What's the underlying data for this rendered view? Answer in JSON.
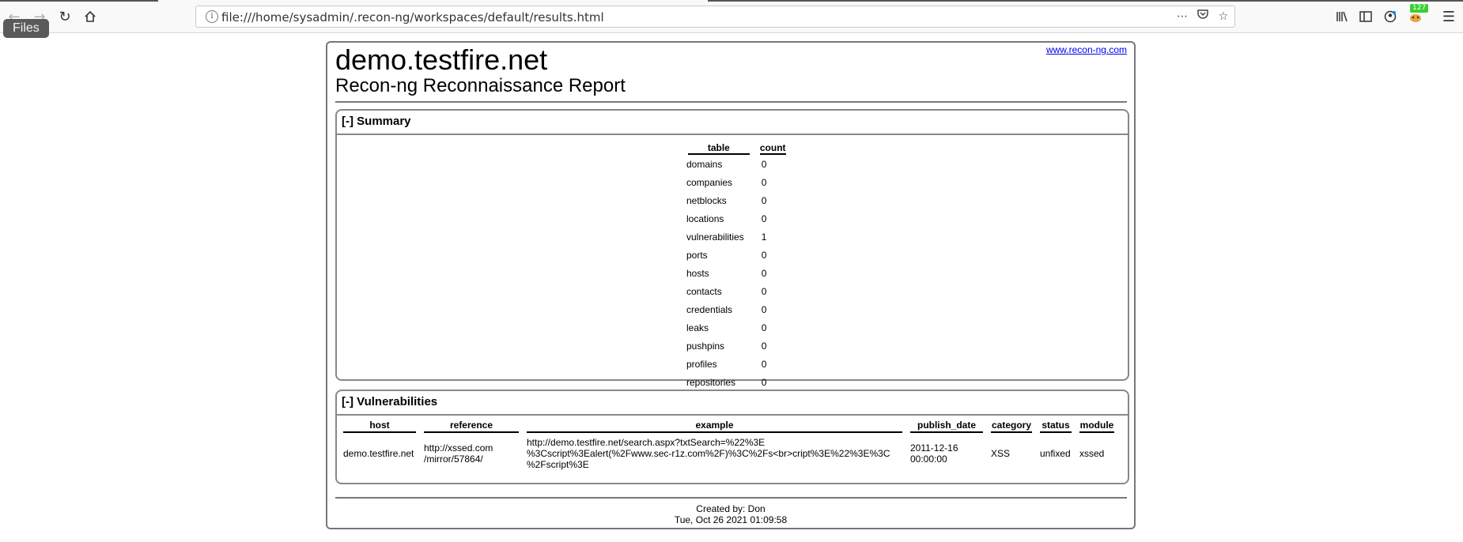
{
  "browser": {
    "url": "file:///home/sysadmin/.recon-ng/workspaces/default/results.html",
    "tooltip": "Files",
    "badge_count": "127",
    "icons": [
      "back-icon",
      "forward-icon",
      "reload-icon",
      "home-icon",
      "info-icon",
      "more-icon",
      "pocket-icon",
      "star-icon",
      "library-icon",
      "sidebar-icon",
      "account-icon",
      "extension-icon",
      "menu-icon"
    ]
  },
  "report": {
    "title": "demo.testfire.net",
    "subtitle": "Recon-ng Reconnaissance Report",
    "link": "www.recon-ng.com",
    "summary": {
      "heading": "[-] Summary",
      "columns": [
        "table",
        "count"
      ],
      "rows": [
        [
          "domains",
          "0"
        ],
        [
          "companies",
          "0"
        ],
        [
          "netblocks",
          "0"
        ],
        [
          "locations",
          "0"
        ],
        [
          "vulnerabilities",
          "1"
        ],
        [
          "ports",
          "0"
        ],
        [
          "hosts",
          "0"
        ],
        [
          "contacts",
          "0"
        ],
        [
          "credentials",
          "0"
        ],
        [
          "leaks",
          "0"
        ],
        [
          "pushpins",
          "0"
        ],
        [
          "profiles",
          "0"
        ],
        [
          "repositories",
          "0"
        ]
      ]
    },
    "vulnerabilities": {
      "heading": "[-] Vulnerabilities",
      "columns": [
        "host",
        "reference",
        "example",
        "publish_date",
        "category",
        "status",
        "module"
      ],
      "rows": [
        {
          "host": "demo.testfire.net",
          "reference": [
            "http://xssed.com",
            "/mirror/57864/"
          ],
          "example": [
            "http://demo.testfire.net/search.aspx?txtSearch=%22%3E",
            "%3Cscript%3Ealert(%2Fwww.sec-r1z.com%2F)%3C%2Fs<br>cript%3E%22%3E%3C",
            "%2Fscript%3E"
          ],
          "publish_date": [
            "2011-12-16",
            "00:00:00"
          ],
          "category": "XSS",
          "status": "unfixed",
          "module": "xssed"
        }
      ]
    },
    "footer": {
      "created_by": "Created by: Don",
      "timestamp": "Tue, Oct 26 2021 01:09:58"
    }
  }
}
